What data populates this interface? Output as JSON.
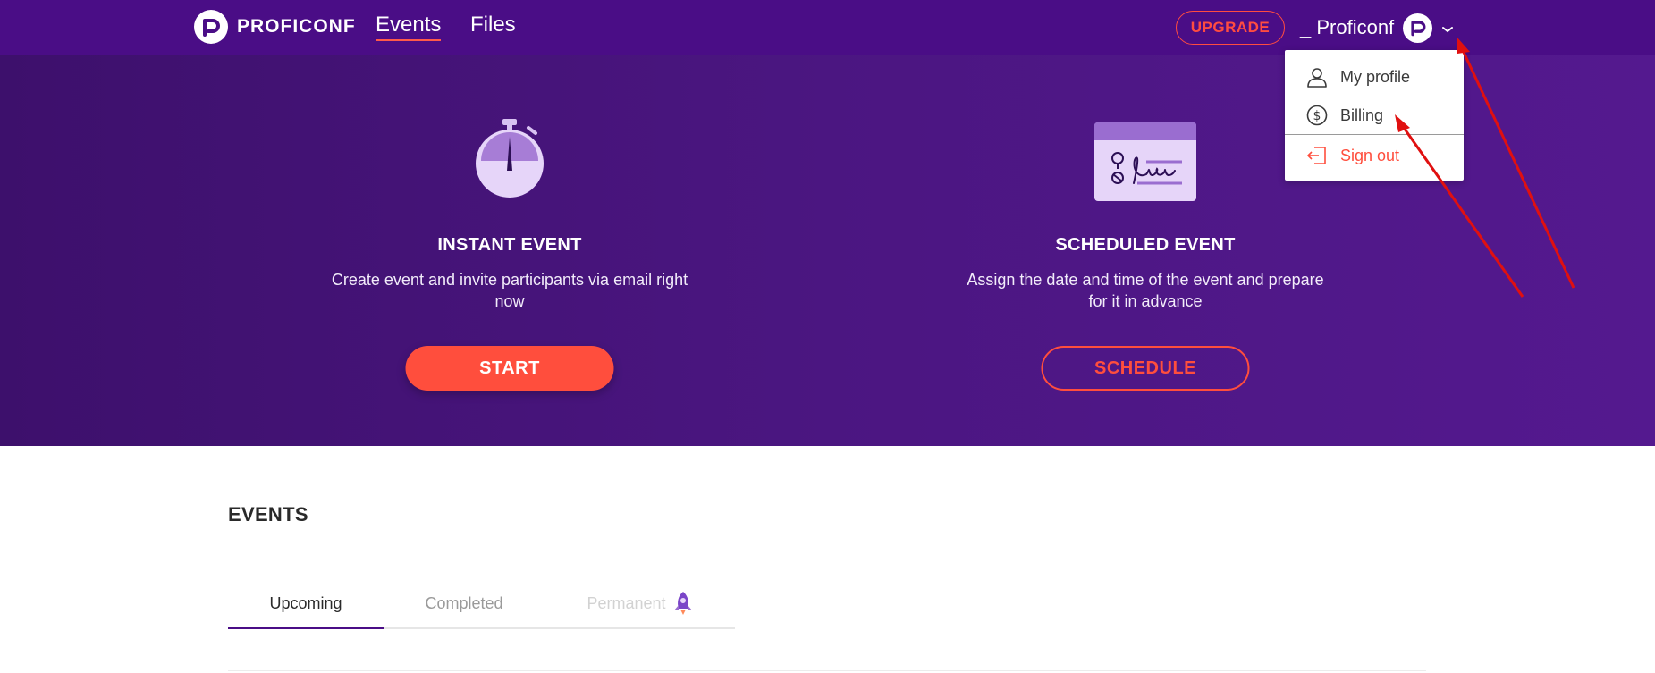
{
  "header": {
    "logo_text": "PROFICONF",
    "nav": [
      {
        "label": "Events",
        "active": true
      },
      {
        "label": "Files",
        "active": false
      }
    ],
    "upgrade_label": "UPGRADE",
    "user_name": "_ Proficonf",
    "icons": {
      "logo": "proficonf-logo-icon",
      "avatar": "avatar-icon",
      "chevron": "chevron-down-icon"
    }
  },
  "hero": {
    "instant": {
      "icon": "stopwatch-icon",
      "title": "INSTANT EVENT",
      "description": "Create event and invite participants via email right now",
      "button": "START"
    },
    "scheduled": {
      "icon": "calendar-signature-icon",
      "title": "SCHEDULED EVENT",
      "description": "Assign the date and time of the event and prepare for it in advance",
      "button": "SCHEDULE"
    }
  },
  "dropdown": {
    "items": [
      {
        "label": "My profile",
        "icon": "user-icon"
      },
      {
        "label": "Billing",
        "icon": "dollar-icon"
      },
      {
        "label": "Sign out",
        "icon": "sign-out-icon"
      }
    ]
  },
  "events": {
    "title": "EVENTS",
    "tabs": [
      {
        "label": "Upcoming",
        "state": "active"
      },
      {
        "label": "Completed",
        "state": "inactive"
      },
      {
        "label": "Permanent",
        "state": "disabled",
        "icon": "rocket-icon"
      }
    ]
  },
  "colors": {
    "brand_purple": "#4a0d86",
    "accent_red": "#ff4e3d",
    "annotation_arrow": "#e01010"
  }
}
